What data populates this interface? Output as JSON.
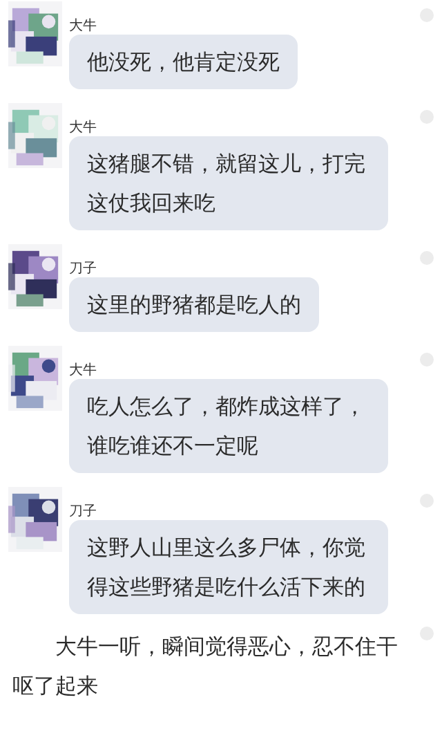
{
  "messages": [
    {
      "sender": "大牛",
      "text": "他没死，他肯定没死"
    },
    {
      "sender": "大牛",
      "text": "这猪腿不错，就留这儿，打完这仗我回来吃"
    },
    {
      "sender": "刀子",
      "text": "这里的野猪都是吃人的"
    },
    {
      "sender": "大牛",
      "text": "吃人怎么了，都炸成这样了，谁吃谁还不一定呢"
    },
    {
      "sender": "刀子",
      "text": "这野人山里这么多尸体，你觉得这些野猪是吃什么活下来的"
    }
  ],
  "narration": "大牛一听，瞬间觉得恶心，忍不住干呕了起来"
}
